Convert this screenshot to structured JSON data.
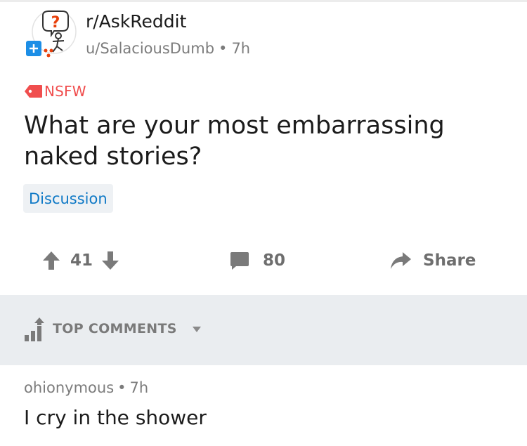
{
  "post": {
    "subreddit": "r/AskReddit",
    "author": "u/SalaciousDumb",
    "separator": "•",
    "age": "7h",
    "nsfw_label": "NSFW",
    "title": "What are your most embarrassing naked stories?",
    "flair": "Discussion"
  },
  "actions": {
    "score": "41",
    "comment_count": "80",
    "share_label": "Share"
  },
  "sort": {
    "label": "TOP COMMENTS"
  },
  "comment": {
    "author": "ohionymous",
    "separator": "•",
    "age": "7h",
    "body": "I cry in the shower"
  },
  "colors": {
    "nsfw": "#f04e4e",
    "flair_text": "#0f79c6",
    "flair_bg": "#eef1f4",
    "muted": "#7c7c7c",
    "band": "#eaedf0"
  },
  "icons": {
    "avatar": "subreddit-avatar-icon",
    "nsfw": "nsfw-tag-icon",
    "upvote": "upvote-arrow-icon",
    "downvote": "downvote-arrow-icon",
    "comments": "comment-bubble-icon",
    "share": "share-arrow-icon",
    "sort": "sort-bars-icon",
    "caret": "chevron-down-icon"
  }
}
